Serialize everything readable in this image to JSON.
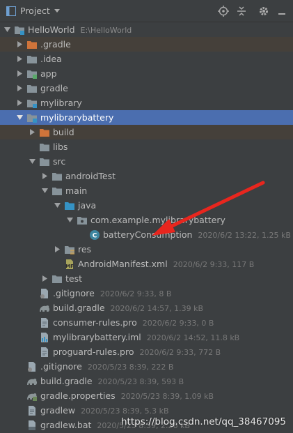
{
  "toolbar": {
    "title": "Project",
    "icons": [
      "project-view-icon",
      "dropdown-icon",
      "locate-icon",
      "collapse-all-icon",
      "settings-gear-icon",
      "hide-icon"
    ]
  },
  "tree": [
    {
      "name": "HelloWorld",
      "meta": "E:\\HelloWorld",
      "icon": "module-folder-icon",
      "arrow": "down",
      "depth": 0
    },
    {
      "name": ".gradle",
      "meta": "",
      "icon": "folder-orange-icon",
      "arrow": "right",
      "depth": 1,
      "state": "excluded"
    },
    {
      "name": ".idea",
      "meta": "",
      "icon": "folder-icon",
      "arrow": "right",
      "depth": 1
    },
    {
      "name": "app",
      "meta": "",
      "icon": "app-module-folder-icon",
      "arrow": "right",
      "depth": 1
    },
    {
      "name": "gradle",
      "meta": "",
      "icon": "folder-icon",
      "arrow": "right",
      "depth": 1
    },
    {
      "name": "mylibrary",
      "meta": "",
      "icon": "library-module-folder-icon",
      "arrow": "right",
      "depth": 1
    },
    {
      "name": "mylibrarybattery",
      "meta": "",
      "icon": "library-module-folder-icon",
      "arrow": "down",
      "depth": 1,
      "state": "selected"
    },
    {
      "name": "build",
      "meta": "",
      "icon": "folder-orange-icon",
      "arrow": "right",
      "depth": 2,
      "state": "excluded"
    },
    {
      "name": "libs",
      "meta": "",
      "icon": "folder-icon",
      "arrow": "none",
      "depth": 2
    },
    {
      "name": "src",
      "meta": "",
      "icon": "folder-icon",
      "arrow": "down",
      "depth": 2
    },
    {
      "name": "androidTest",
      "meta": "",
      "icon": "folder-icon",
      "arrow": "right",
      "depth": 3
    },
    {
      "name": "main",
      "meta": "",
      "icon": "folder-icon",
      "arrow": "down",
      "depth": 3
    },
    {
      "name": "java",
      "meta": "",
      "icon": "source-folder-blue-icon",
      "arrow": "down",
      "depth": 4
    },
    {
      "name": "com.example.mylibrarybattery",
      "meta": "",
      "icon": "package-icon",
      "arrow": "down",
      "depth": 5
    },
    {
      "name": "batteryConsumption",
      "meta": "2020/6/2 13:22, 1.25 kB",
      "icon": "java-class-icon",
      "arrow": "none",
      "depth": 6
    },
    {
      "name": "res",
      "meta": "",
      "icon": "resources-folder-icon",
      "arrow": "right",
      "depth": 4
    },
    {
      "name": "AndroidManifest.xml",
      "meta": "2020/6/2 9:33, 117 B",
      "icon": "manifest-file-icon",
      "arrow": "none",
      "depth": 4
    },
    {
      "name": "test",
      "meta": "",
      "icon": "folder-icon",
      "arrow": "right",
      "depth": 3
    },
    {
      "name": ".gitignore",
      "meta": "2020/6/2 9:33, 8 B",
      "icon": "gitignore-file-icon",
      "arrow": "none",
      "depth": 2
    },
    {
      "name": "build.gradle",
      "meta": "2020/6/2 14:57, 1.39 kB",
      "icon": "gradle-file-icon",
      "arrow": "none",
      "depth": 2
    },
    {
      "name": "consumer-rules.pro",
      "meta": "2020/6/2 9:33, 0 B",
      "icon": "text-file-icon",
      "arrow": "none",
      "depth": 2
    },
    {
      "name": "mylibrarybattery.iml",
      "meta": "2020/6/2 14:52, 11.8 kB",
      "icon": "iml-file-icon",
      "arrow": "none",
      "depth": 2
    },
    {
      "name": "proguard-rules.pro",
      "meta": "2020/6/2 9:33, 772 B",
      "icon": "text-file-icon",
      "arrow": "none",
      "depth": 2
    },
    {
      "name": ".gitignore",
      "meta": "2020/5/23 8:39, 222 B",
      "icon": "gitignore-file-icon",
      "arrow": "none",
      "depth": 1
    },
    {
      "name": "build.gradle",
      "meta": "2020/5/23 8:39, 593 B",
      "icon": "gradle-file-icon",
      "arrow": "none",
      "depth": 1
    },
    {
      "name": "gradle.properties",
      "meta": "2020/5/23 8:39, 1.09 kB",
      "icon": "gradle-properties-file-icon",
      "arrow": "none",
      "depth": 1
    },
    {
      "name": "gradlew",
      "meta": "2020/5/23 8:39, 5.3 kB",
      "icon": "text-file-icon",
      "arrow": "none",
      "depth": 1
    },
    {
      "name": "gradlew.bat",
      "meta": "2020/5/23 8:39, 2.26 kB",
      "icon": "bat-file-icon",
      "arrow": "none",
      "depth": 1
    }
  ],
  "watermark": "https://blog.csdn.net/qq_38467095",
  "colors": {
    "panel": "#3c3f41",
    "selection": "#4b6eaf",
    "excluded": "#45403a",
    "annotation_arrow": "#e8261e"
  }
}
